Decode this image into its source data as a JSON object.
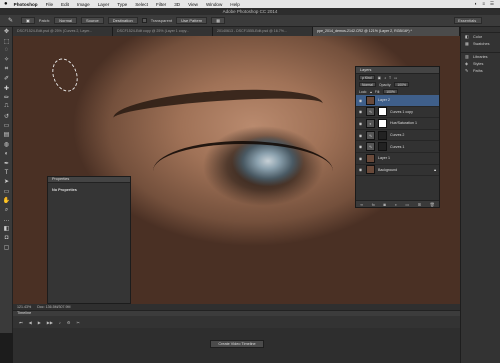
{
  "menubar": {
    "apple": "",
    "items": [
      "Photoshop",
      "File",
      "Edit",
      "Image",
      "Layer",
      "Type",
      "Select",
      "Filter",
      "3D",
      "View",
      "Window",
      "Help"
    ],
    "right": [
      "◐",
      "≡",
      "☰"
    ]
  },
  "window": {
    "title": "Adobe Photoshop CC 2014"
  },
  "options": {
    "feather_label": "Feather:",
    "feather_value": "0 px",
    "patch_label": "Patch:",
    "patch_value": "Normal",
    "source": "Source",
    "destination": "Destination",
    "transparent": "Transparent",
    "use_pattern": "Use Pattern",
    "workspace": "Essentials"
  },
  "tabs": [
    {
      "label": "DSCF1524-Edit.psd @ 25% (Curves 2, Layer..."
    },
    {
      "label": "DSCF1524-Edit copy @ 25% (Layer 1 copy..."
    },
    {
      "label": "20140613 - DSCF1555-Edit.psd @ 16.7%..."
    },
    {
      "label": "ppe_2014_demos-2142.CR2 @ 121% (Layer 2, RGB/16*) *"
    }
  ],
  "status": {
    "zoom": "121.43%",
    "doc": "Doc: 136.5M/307.9M"
  },
  "timeline": {
    "title": "Timeline",
    "create_button": "Create Video Timeline"
  },
  "properties": {
    "title": "Properties",
    "body": "No Properties"
  },
  "layers": {
    "title": "Layers",
    "kind": "ρ Kind",
    "blend": "Normal",
    "opacity_label": "Opacity:",
    "opacity": "100%",
    "lock_label": "Lock:",
    "fill_label": "Fill:",
    "fill": "100%",
    "items": [
      {
        "name": "Layer 2",
        "type": "pixel",
        "active": true
      },
      {
        "name": "Curves 1 copy",
        "type": "adjustment",
        "mask": "light"
      },
      {
        "name": "Hue/Saturation 1",
        "type": "adjustment",
        "mask": "light"
      },
      {
        "name": "Curves 2",
        "type": "adjustment",
        "mask": "dark"
      },
      {
        "name": "Curves 1",
        "type": "adjustment",
        "mask": "dark"
      },
      {
        "name": "Layer 1",
        "type": "pixel"
      },
      {
        "name": "Background",
        "type": "pixel",
        "locked": true
      }
    ]
  },
  "dock": [
    {
      "icon": "color-icon",
      "label": "Color"
    },
    {
      "icon": "swatches-icon",
      "label": "Swatches"
    },
    {
      "icon": "libraries-icon",
      "label": "Libraries"
    },
    {
      "icon": "styles-icon",
      "label": "Styles"
    },
    {
      "icon": "paths-icon",
      "label": "Paths"
    }
  ],
  "colors": {
    "accent": "#3f5f8a",
    "panel": "#323232",
    "menubar": "#e6e6e6"
  }
}
